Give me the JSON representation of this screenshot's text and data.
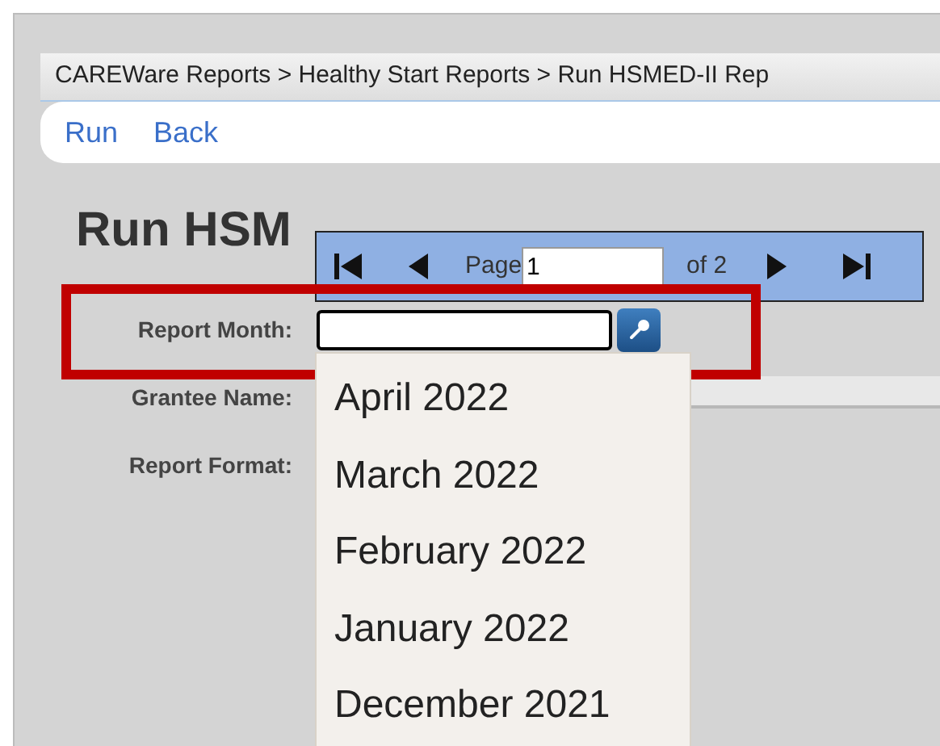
{
  "breadcrumb": "CAREWare Reports > Healthy Start Reports > Run HSMED-II Rep",
  "toolbar": [
    {
      "label": "Run"
    },
    {
      "label": "Back"
    }
  ],
  "title": "Run HSM",
  "pager": {
    "page_label": "Page",
    "page_value": "1",
    "of_label": "of 2"
  },
  "fields": [
    {
      "label": "Report Month:",
      "kind": "lookup"
    },
    {
      "label": "Grantee Name:",
      "kind": "bar"
    },
    {
      "label": "Report Format:",
      "kind": "none"
    }
  ],
  "dropdown": [
    {
      "label": "April 2022"
    },
    {
      "label": "March 2022"
    },
    {
      "label": "February 2022"
    },
    {
      "label": "January 2022"
    },
    {
      "label": "December 2021"
    }
  ]
}
